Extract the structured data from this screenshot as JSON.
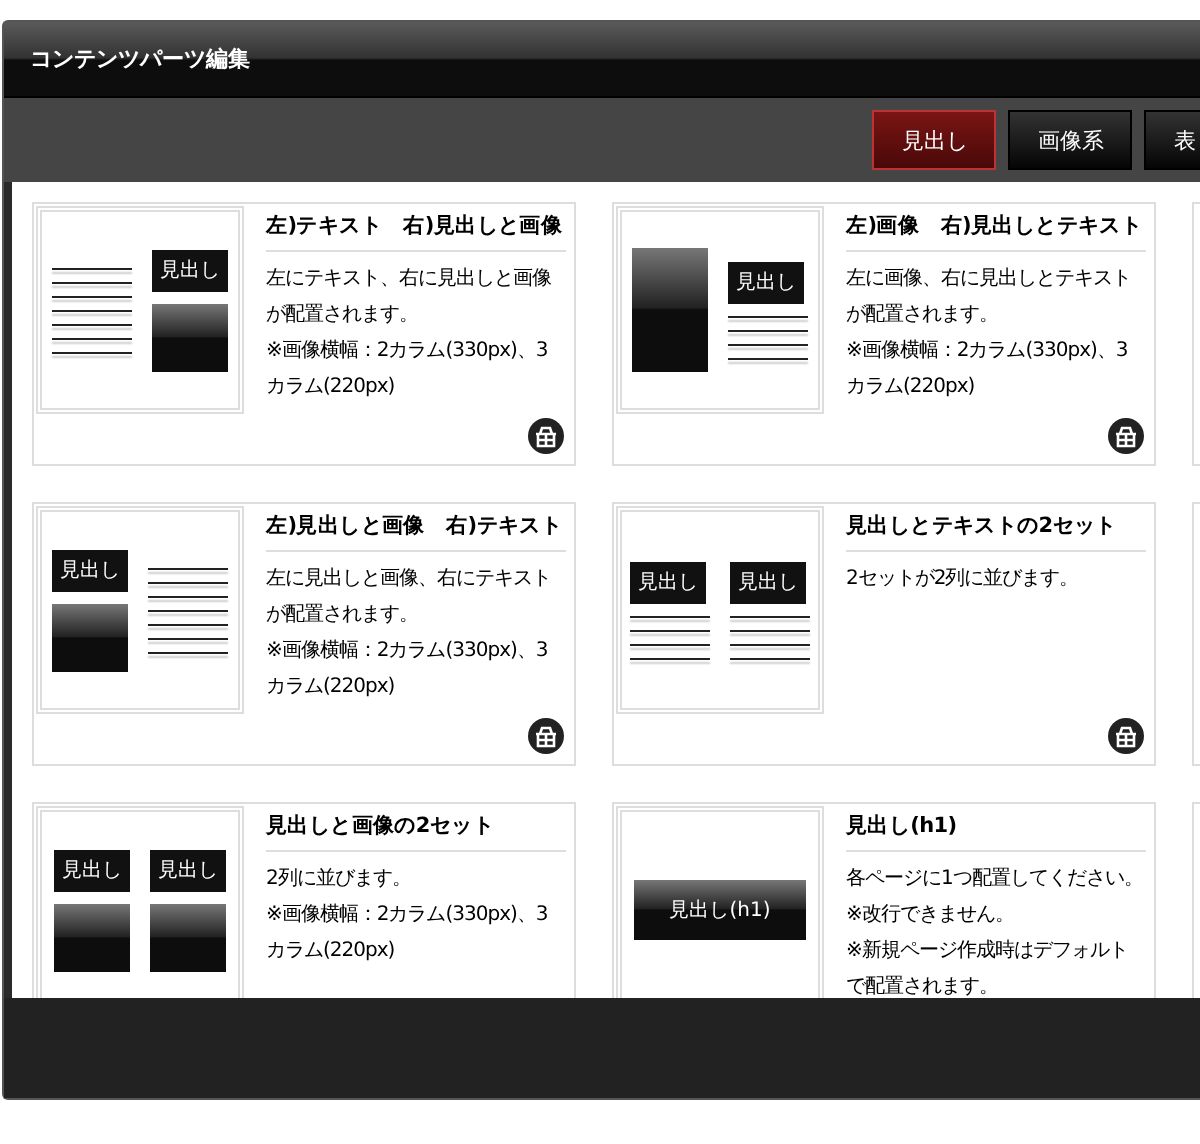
{
  "window": {
    "title": "コンテンツパーツ編集"
  },
  "tabs": [
    {
      "label": "見出し",
      "selected": true
    },
    {
      "label": "画像系",
      "selected": false
    },
    {
      "label": "表",
      "selected": false
    }
  ],
  "parts": [
    {
      "title": "左)テキスト　右)見出しと画像",
      "description": [
        "左にテキスト、右に見出しと画像が配置されます。",
        "※画像横幅：2カラム(330px)、3カラム(220px)"
      ],
      "thumbnail": {
        "kind": "text-heading-image",
        "labels": [
          "見出し"
        ]
      },
      "delete_button": true
    },
    {
      "title": "左)画像　右)見出しとテキスト",
      "description": [
        "左に画像、右に見出しとテキストが配置されます。",
        "※画像横幅：2カラム(330px)、3カラム(220px)"
      ],
      "thumbnail": {
        "kind": "image-heading-text",
        "labels": [
          "見出し"
        ]
      },
      "delete_button": true
    },
    {
      "title": "左)見出しと画像　右)テキスト",
      "description": [
        "左に見出しと画像、右にテキストが配置されます。",
        "※画像横幅：2カラム(330px)、3カラム(220px)"
      ],
      "thumbnail": {
        "kind": "heading-image-text",
        "labels": [
          "見出し"
        ]
      },
      "delete_button": true
    },
    {
      "title": "見出しとテキストの2セット",
      "description": [
        "2セットが2列に並びます。"
      ],
      "thumbnail": {
        "kind": "heading-text-pair",
        "labels": [
          "見出し",
          "見出し"
        ]
      },
      "delete_button": true
    },
    {
      "title": "見出しと画像の2セット",
      "description": [
        "2列に並びます。",
        "※画像横幅：2カラム(330px)、3カラム(220px)"
      ],
      "thumbnail": {
        "kind": "heading-image-pair",
        "labels": [
          "見出し",
          "見出し"
        ]
      }
    },
    {
      "title": "見出し(h1)",
      "description": [
        "各ページに1つ配置してください。",
        "※改行できません。",
        "※新規ページ作成時はデフォルトで配置されます。"
      ],
      "thumbnail": {
        "kind": "h1",
        "labels": [
          "見出し(h1)"
        ]
      }
    }
  ]
}
